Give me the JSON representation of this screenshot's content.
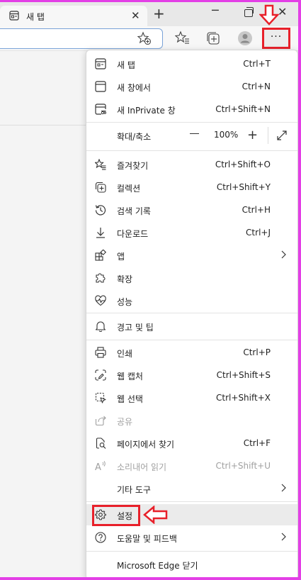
{
  "tab": {
    "title": "새 탭"
  },
  "more_button": {
    "label": "···"
  },
  "menu": {
    "new_tab": {
      "label": "새 탭",
      "shortcut": "Ctrl+T"
    },
    "new_window": {
      "label": "새 창에서",
      "shortcut": "Ctrl+N"
    },
    "new_inprivate": {
      "label": "새 InPrivate 창",
      "shortcut": "Ctrl+Shift+N"
    },
    "zoom": {
      "label": "확대/축소",
      "value": "100%"
    },
    "favorites": {
      "label": "즐겨찾기",
      "shortcut": "Ctrl+Shift+O"
    },
    "collections": {
      "label": "컬렉션",
      "shortcut": "Ctrl+Shift+Y"
    },
    "history": {
      "label": "검색 기록",
      "shortcut": "Ctrl+H"
    },
    "downloads": {
      "label": "다운로드",
      "shortcut": "Ctrl+J"
    },
    "apps": {
      "label": "앱"
    },
    "extensions": {
      "label": "확장"
    },
    "performance": {
      "label": "성능"
    },
    "alerts": {
      "label": "경고 및 팁"
    },
    "print": {
      "label": "인쇄",
      "shortcut": "Ctrl+P"
    },
    "web_capture": {
      "label": "웹 캡처",
      "shortcut": "Ctrl+Shift+S"
    },
    "web_select": {
      "label": "웹 선택",
      "shortcut": "Ctrl+Shift+X"
    },
    "share": {
      "label": "공유"
    },
    "find_on_page": {
      "label": "페이지에서 찾기",
      "shortcut": "Ctrl+F"
    },
    "read_aloud": {
      "label": "소리내어 읽기",
      "shortcut": "Ctrl+Shift+U"
    },
    "more_tools": {
      "label": "기타 도구"
    },
    "settings": {
      "label": "설정"
    },
    "help": {
      "label": "도움말 및 피드백"
    },
    "close_edge": {
      "label": "Microsoft Edge 닫기"
    }
  },
  "colors": {
    "annotation": "#e8202a",
    "frame": "#e33fe6",
    "hover": "#ebebeb"
  }
}
